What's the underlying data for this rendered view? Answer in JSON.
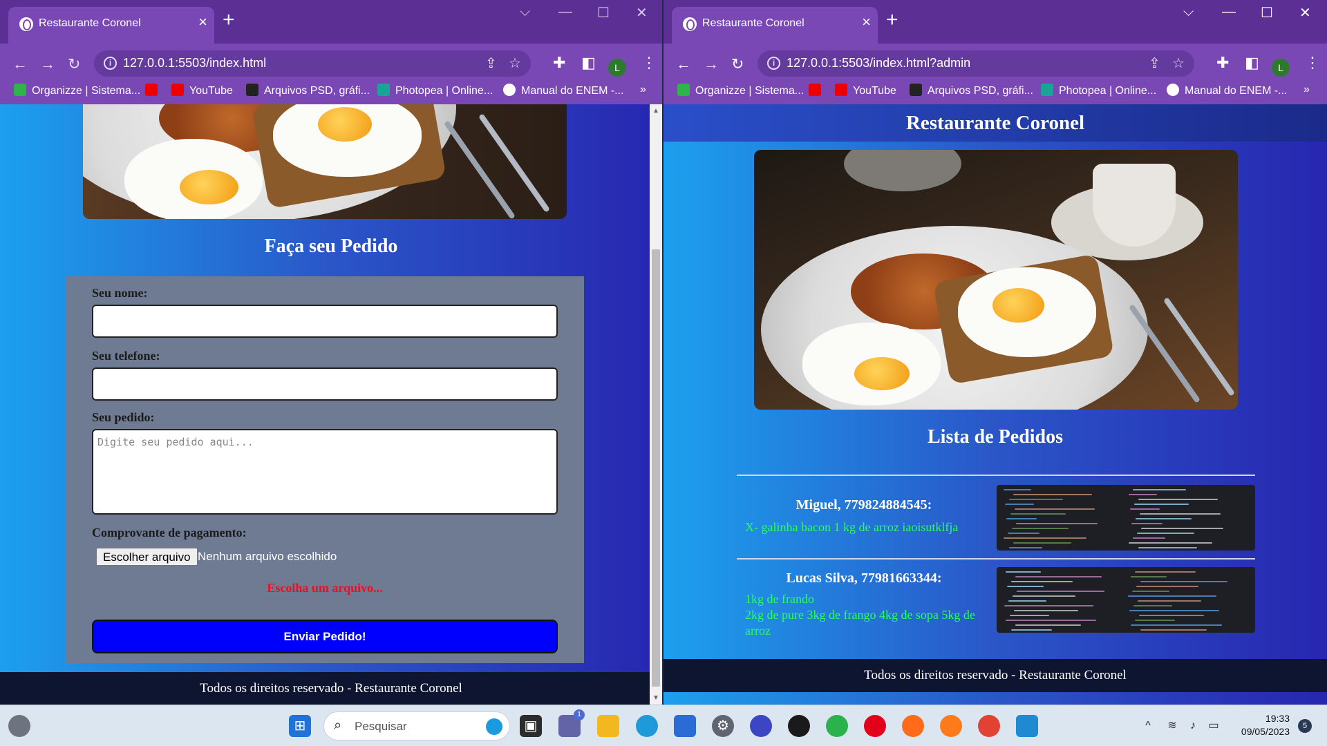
{
  "left_window": {
    "tab_title": "Restaurante Coronel",
    "url": "127.0.0.1:5503/index.html",
    "bookmarks": [
      "Organizze | Sistema...",
      "YouTube",
      "Arquivos PSD, gráfi...",
      "Photopea | Online...",
      "Manual do ENEM -..."
    ],
    "avatar_letter": "L",
    "page": {
      "section_title": "Faça seu Pedido",
      "name_label": "Seu nome:",
      "phone_label": "Seu telefone:",
      "order_label": "Seu pedido:",
      "order_placeholder": "Digite seu pedido aqui...",
      "receipt_label": "Comprovante de pagamento:",
      "file_button": "Escolher arquivo",
      "file_status": "Nenhum arquivo escolhido",
      "error_text": "Escolha um arquivo...",
      "submit_label": "Enviar Pedido!",
      "footer": "Todos os direitos reservado - Restaurante Coronel"
    }
  },
  "right_window": {
    "tab_title": "Restaurante Coronel",
    "url": "127.0.0.1:5503/index.html?admin",
    "bookmarks": [
      "Organizze | Sistema...",
      "YouTube",
      "Arquivos PSD, gráfi...",
      "Photopea | Online...",
      "Manual do ENEM -..."
    ],
    "avatar_letter": "L",
    "page": {
      "header": "Restaurante Coronel",
      "section_title": "Lista de Pedidos",
      "orders": [
        {
          "name": "Miguel, 779824884545:",
          "lines": [
            "X- galinha bacon 1 kg de arroz iaoisutklfja"
          ]
        },
        {
          "name": "Lucas Silva, 77981663344:",
          "lines": [
            "1kg de frando",
            "2kg de pure 3kg de frango 4kg de sopa 5kg de arroz"
          ]
        }
      ],
      "footer": "Todos os direitos reservado - Restaurante Coronel"
    }
  },
  "taskbar": {
    "search_placeholder": "Pesquisar",
    "time": "19:33",
    "date": "09/05/2023",
    "notification_count": "5",
    "teams_badge": "1"
  },
  "colors": {
    "browser_frame": "#5b2f94",
    "page_gradient_start": "#1ca0ee",
    "page_gradient_end": "#2726b0",
    "submit_button": "#0000ff",
    "order_text": "#2bff53",
    "error_text": "#e81123"
  }
}
